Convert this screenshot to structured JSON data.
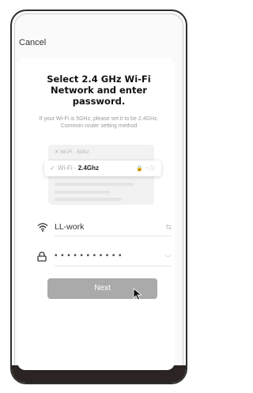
{
  "header": {
    "cancel_label": "Cancel"
  },
  "main": {
    "title": "Select 2.4 GHz Wi-Fi Network and enter password.",
    "subtitle": "If your Wi-Fi is 5GHz, please set it to be 2.4GHz. Common router setting method"
  },
  "illustration": {
    "wifi_5g_label": "Wi-Fi - 5Ghz",
    "wifi_24_prefix": "Wi-Fi - ",
    "wifi_24_band": "2.4Ghz"
  },
  "form": {
    "network_name": "LL-work",
    "password_masked": "•••••••••••",
    "next_label": "Next"
  },
  "icons": {
    "wifi": "wifi-icon",
    "lock": "lock-icon",
    "switch": "switch-network-icon",
    "eye": "hide-password-icon",
    "cursor": "mouse-cursor-icon"
  }
}
